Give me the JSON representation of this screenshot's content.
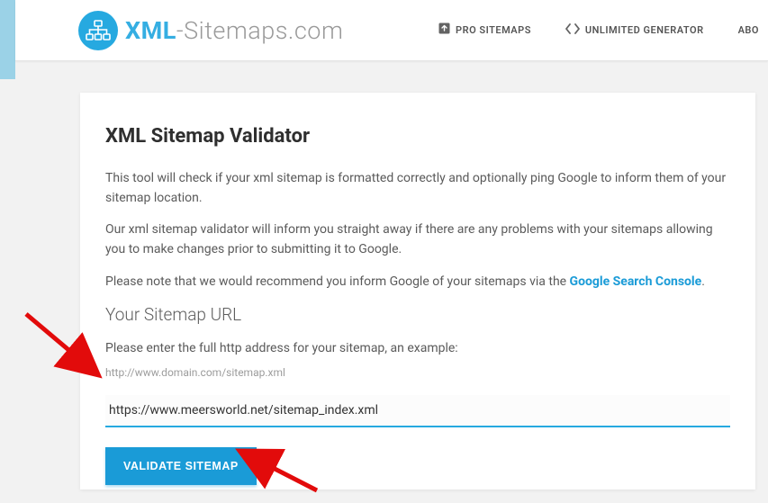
{
  "brand": {
    "bold": "XML",
    "thin": "-Sitemaps.com"
  },
  "nav": {
    "pro": "PRO SITEMAPS",
    "unl": "UNLIMITED GENERATOR",
    "about": "ABO"
  },
  "card": {
    "title": "XML Sitemap Validator",
    "p1": "This tool will check if your xml sitemap is formatted correctly and optionally ping Google to inform them of your sitemap location.",
    "p2": "Our xml sitemap validator will inform you straight away if there are any problems with your sitemaps allowing you to make changes prior to submitting it to Google.",
    "p3a": "Please note that we would recommend you inform Google of your sitemaps via the ",
    "p3link": "Google Search Console",
    "p3b": ".",
    "subhead": "Your Sitemap URL",
    "instruction": "Please enter the full http address for your sitemap, an example:",
    "example": "http://www.domain.com/sitemap.xml",
    "input_value": "https://www.meersworld.net/sitemap_index.xml",
    "button": "VALIDATE SITEMAP"
  }
}
